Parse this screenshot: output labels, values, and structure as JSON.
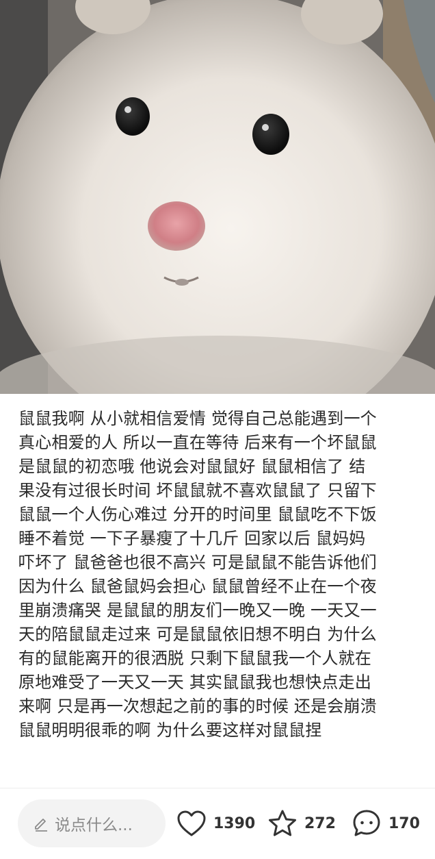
{
  "photo": {
    "description_icon": "hamster-photo"
  },
  "post": {
    "lines": [
      "鼠鼠我啊 从小就相信爱情 觉得自己总能遇到一个",
      "真心相爱的人 所以一直在等待 后来有一个坏鼠鼠",
      "是鼠鼠的初恋哦 他说会对鼠鼠好 鼠鼠相信了 结",
      "果没有过很长时间 坏鼠鼠就不喜欢鼠鼠了 只留下",
      "鼠鼠一个人伤心难过 分开的时间里 鼠鼠吃不下饭",
      "睡不着觉 一下子暴瘦了十几斤 回家以后 鼠妈妈",
      "吓坏了 鼠爸爸也很不高兴 可是鼠鼠不能告诉他们",
      "因为什么 鼠爸鼠妈会担心 鼠鼠曾经不止在一个夜",
      "里崩溃痛哭 是鼠鼠的朋友们一晚又一晚 一天又一",
      "天的陪鼠鼠走过来 可是鼠鼠依旧想不明白 为什么",
      "有的鼠能离开的很洒脱 只剩下鼠鼠我一个人就在",
      "原地难受了一天又一天 其实鼠鼠我也想快点走出",
      "来啊 只是再一次想起之前的事的时候 还是会崩溃",
      "鼠鼠明明很乖的啊 为什么要这样对鼠鼠捏"
    ]
  },
  "bottom_bar": {
    "comment_placeholder": "说点什么...",
    "likes": "1390",
    "favorites": "272",
    "comments": "170",
    "icons": {
      "comment_input": "pen-icon",
      "like": "heart-icon",
      "favorite": "star-icon",
      "comment": "chat-bubble-icon"
    }
  }
}
